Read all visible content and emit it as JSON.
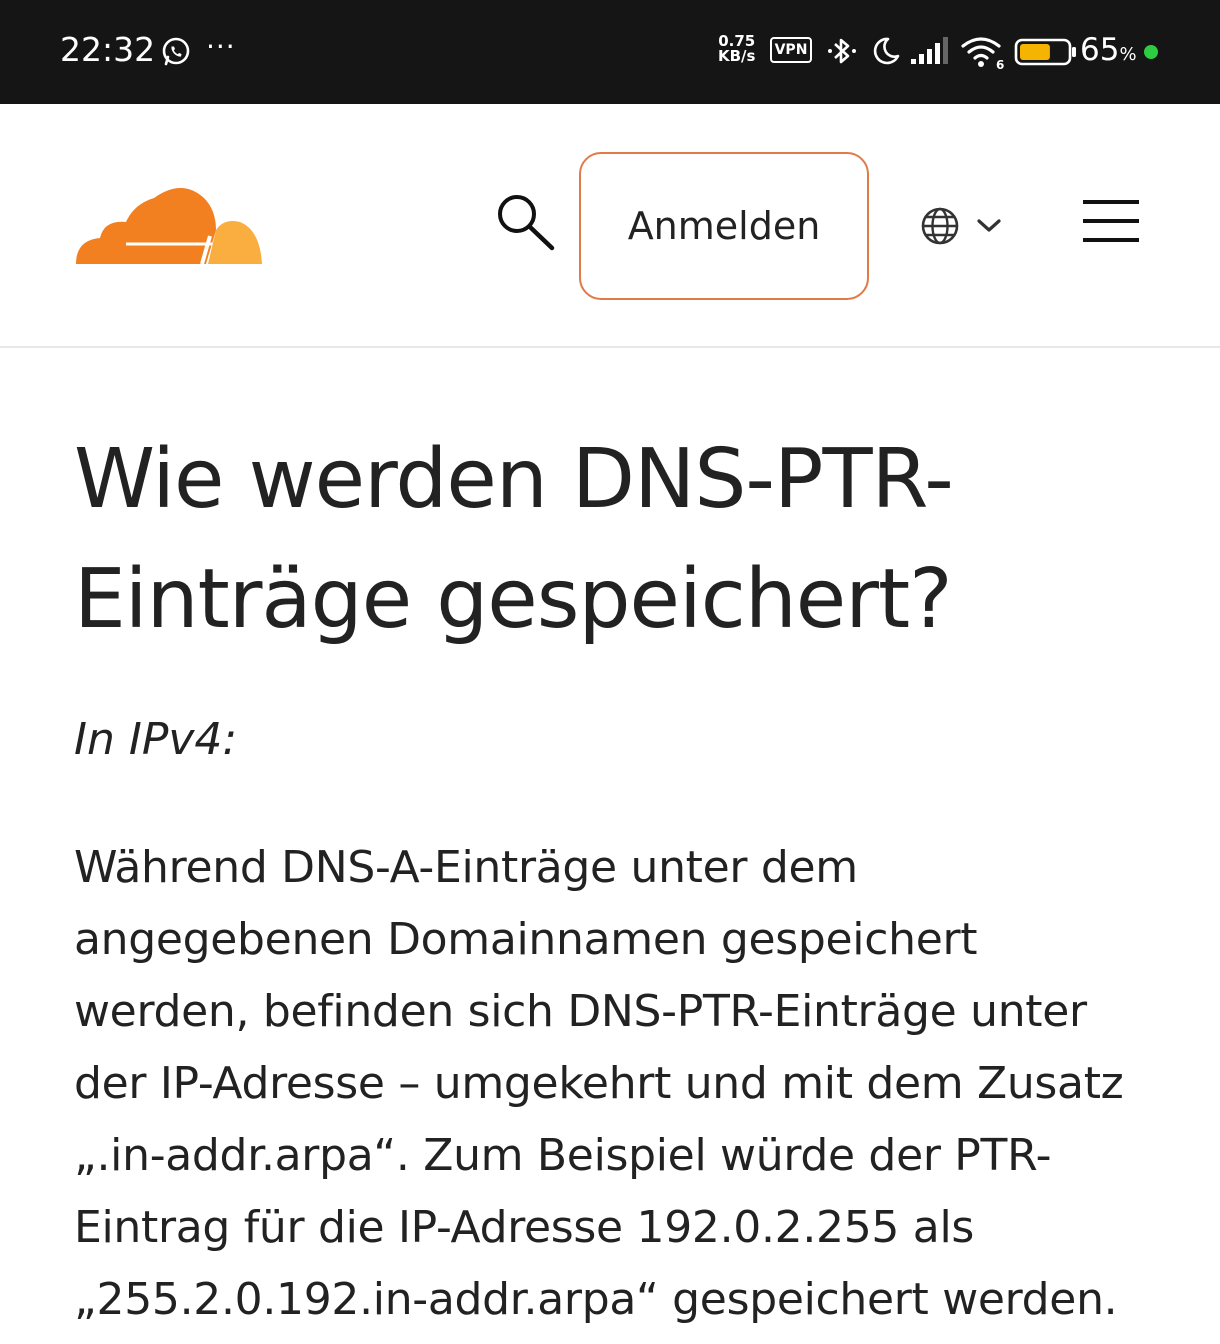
{
  "status_bar": {
    "time": "22:32",
    "net_speed_value": "0.75",
    "net_speed_unit": "KB/s",
    "vpn_label": "VPN",
    "battery_percent": "65",
    "battery_percent_sign": "%",
    "battery_level": 0.65,
    "wifi_badge": "6",
    "overflow": "···"
  },
  "header": {
    "login_label": "Anmelden"
  },
  "article": {
    "title": "Wie werden DNS-PTR-Einträge gespeichert?",
    "subheading": "In IPv4:",
    "paragraph": "Während DNS-A-Einträge unter dem angegebenen Domainnamen gespeichert werden, befinden sich DNS-PTR-Einträge unter der IP-Adresse – umgekehrt und mit dem Zusatz „.in-addr.arpa“. Zum Beispiel würde der PTR-Eintrag für die IP-Adresse 192.0.2.255 als „255.2.0.192.in-addr.arpa“ gespeichert werden."
  },
  "colors": {
    "brand_orange": "#f38020",
    "brand_orange_light": "#faae40",
    "login_border": "#e07b48",
    "status_bar_bg": "#151515",
    "battery_fill": "#f5b400",
    "online_dot": "#2ecc40"
  },
  "icons": {
    "logo": "cloudflare-logo",
    "search": "search-icon",
    "language": "globe-icon",
    "chevron": "chevron-down-icon",
    "menu": "hamburger-menu-icon"
  }
}
